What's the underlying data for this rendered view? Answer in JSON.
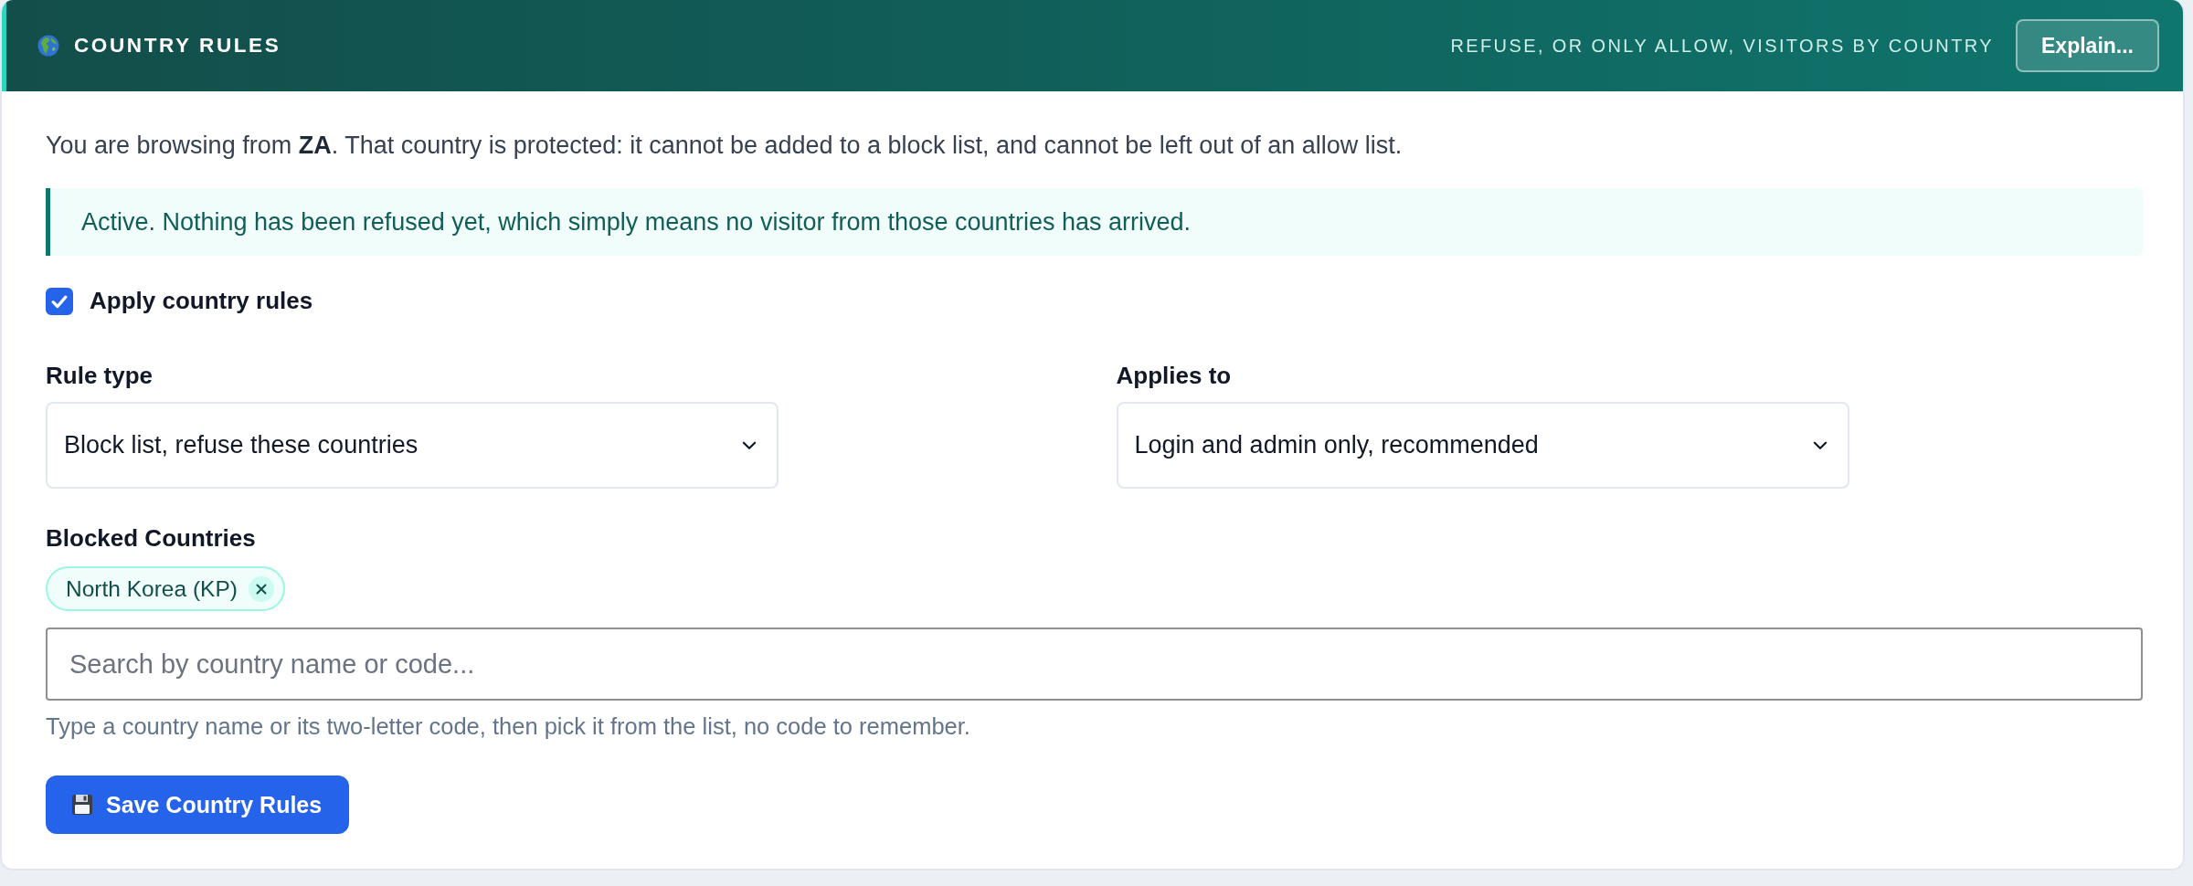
{
  "panel": {
    "title": "COUNTRY RULES",
    "subtitle": "REFUSE, OR ONLY ALLOW, VISITORS BY COUNTRY",
    "explain_button": "Explain..."
  },
  "notice": "You are browsing from **ZA**. That country is protected: it cannot be added to a block list, and cannot be left out of an allow list.",
  "status_alert": "Active. Nothing has been refused yet, which simply means no visitor from those countries has arrived.",
  "apply_rules": {
    "label": "Apply country rules",
    "checked": true
  },
  "fields": [
    {
      "label": "Rule type",
      "value": "Block list, refuse these countries"
    },
    {
      "label": "Applies to",
      "value": "Login and admin only, recommended"
    }
  ],
  "blocked_countries": {
    "label": "Blocked Countries",
    "chips": [
      {
        "label": "North Korea (KP)"
      }
    ],
    "search": {
      "placeholder": "Search by country name or code..."
    },
    "help": "Type a country name or its two-letter code, then pick it from the list, no code to remember."
  },
  "save_button": "Save Country Rules"
}
